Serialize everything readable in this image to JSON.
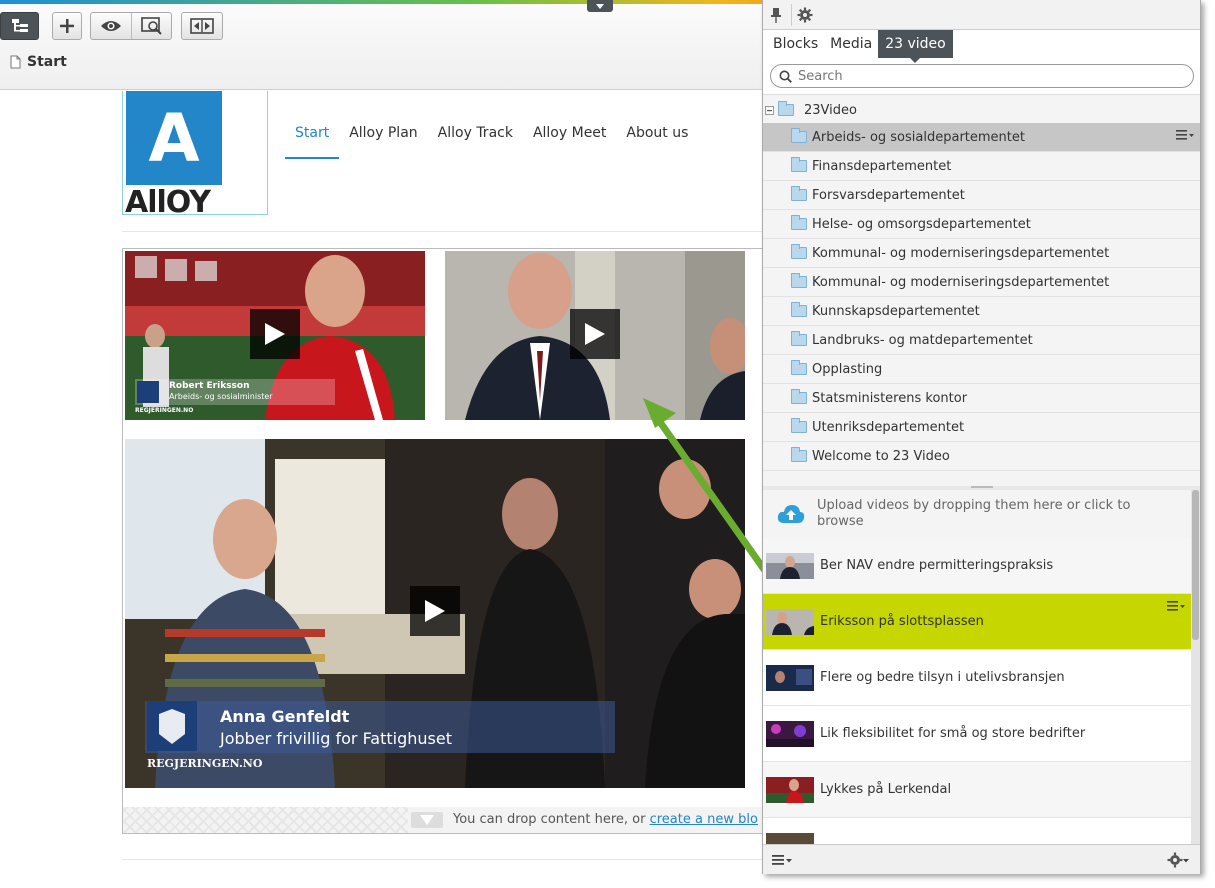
{
  "toolbar": {
    "page_name": "Start"
  },
  "site": {
    "logo_letter": "A",
    "logo_text": "AllOY",
    "nav": [
      "Start",
      "Alloy Plan",
      "Alloy Track",
      "Alloy Meet",
      "About us"
    ],
    "videos": [
      {
        "overlay_name": "Robert Eriksson",
        "overlay_title": "Arbeids- og sosialminister",
        "brand": "REGJERINGEN.NO"
      },
      {},
      {
        "overlay_name": "Anna Genfeldt",
        "overlay_title": "Jobber frivillig for Fattighuset",
        "brand": "REGJERINGEN.NO"
      }
    ],
    "drop_text": "You can drop content here, or ",
    "drop_link": "create a new blo"
  },
  "panel": {
    "tabs": [
      "Blocks",
      "Media",
      "23 video"
    ],
    "search_placeholder": "Search",
    "tree_root": "23Video",
    "folders": [
      "Arbeids- og sosialdepartementet",
      "Finansdepartementet",
      "Forsvarsdepartementet",
      "Helse- og omsorgsdepartementet",
      "Kommunal- og moderniseringsdepartementet",
      "Kommunal- og moderniseringsdepartementet",
      "Kunnskapsdepartementet",
      "Landbruks- og matdepartementet",
      "Opplasting",
      "Statsministerens kontor",
      "Utenriksdepartementet",
      "Welcome to 23 Video"
    ],
    "upload_text": "Upload videos by dropping them here or click to browse",
    "videos": [
      "Ber NAV endre permitteringspraksis",
      "Eriksson på slottsplassen",
      "Flere og bedre tilsyn i utelivsbransjen",
      "Lik fleksibilitet for små og store bedrifter",
      "Lykkes på Lerkendal",
      ""
    ]
  },
  "colors": {
    "accent_blue": "#2286c8",
    "active_item": "#c6d600",
    "dark_tab": "#4d5459",
    "arrow_green": "#6aac2f"
  }
}
